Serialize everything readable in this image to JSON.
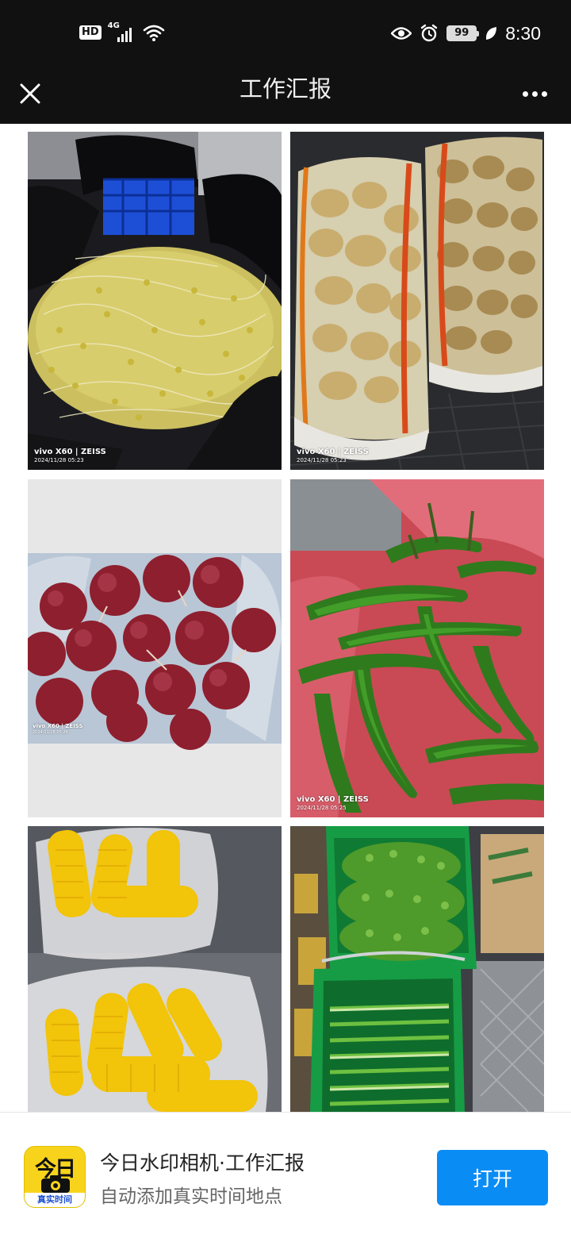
{
  "status_bar": {
    "hd": "HD",
    "network": "4G",
    "battery": "99",
    "time": "8:30",
    "icons": [
      "signal-icon",
      "wifi-icon",
      "eye-icon",
      "alarm-icon",
      "battery-icon",
      "leaf-icon"
    ]
  },
  "nav": {
    "title": "工作汇报",
    "close_icon": "close-icon",
    "more_icon": "more-icon"
  },
  "photos": [
    {
      "subject": "bean-sprouts",
      "watermark": {
        "brand": "vivo X60 | ZEISS",
        "datetime": "2024/11/28 05:23"
      }
    },
    {
      "subject": "potatoes",
      "watermark": {
        "brand": "vivo X60 | ZEISS",
        "datetime": "2024/11/28 05:23"
      }
    },
    {
      "subject": "red-onions",
      "watermark": {
        "brand": "vivo X60 | ZEISS",
        "datetime": "2024/11/28 05:24"
      }
    },
    {
      "subject": "green-peppers",
      "watermark": {
        "brand": "vivo X60 | ZEISS",
        "datetime": "2024/11/28 05:25"
      }
    },
    {
      "subject": "corn",
      "watermark": null
    },
    {
      "subject": "scallions",
      "watermark": null
    }
  ],
  "banner": {
    "icon_text_top": "今日",
    "icon_text_bottom": "真实时间",
    "title": "今日水印相机·工作汇报",
    "subtitle": "自动添加真实时间地点",
    "open_label": "打开"
  },
  "colors": {
    "bar_bg": "#111111",
    "button_blue": "#0a8cf5",
    "icon_yellow": "#f7d31c"
  }
}
